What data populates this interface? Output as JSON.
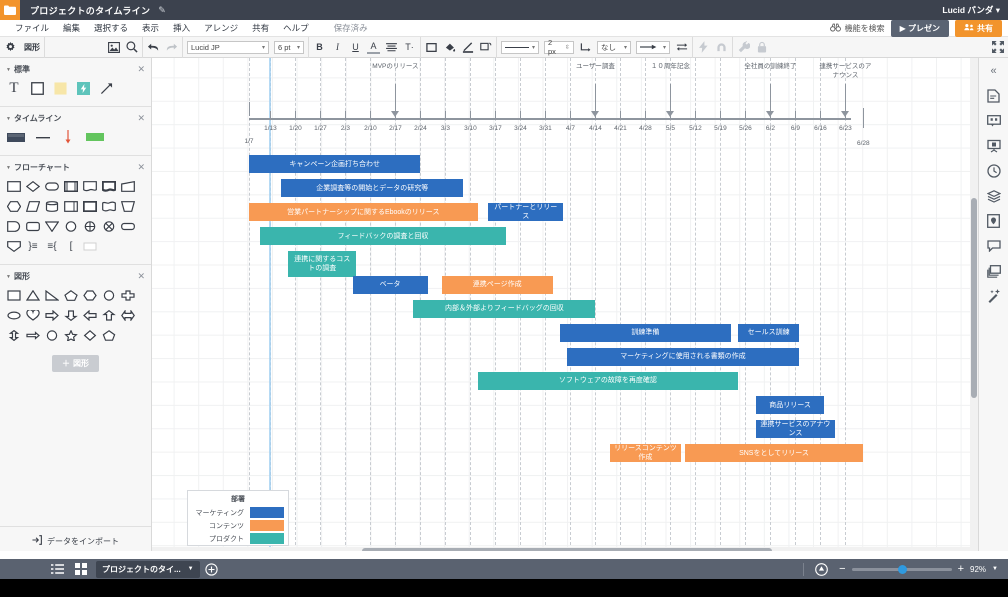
{
  "titlebar": {
    "doc_title": "プロジェクトのタイムライン",
    "edit_icon": "pencil-icon",
    "account": "Lucid パンダ ▾"
  },
  "menubar": {
    "items": [
      "ファイル",
      "編集",
      "選択する",
      "表示",
      "挿入",
      "アレンジ",
      "共有",
      "ヘルプ"
    ],
    "saved_status": "保存済み",
    "search_features": "機能を検索",
    "present_label": "▶ プレゼン",
    "share_label": "共有"
  },
  "toolbar": {
    "shapes_label": "図形",
    "font_family": "Lucid JP",
    "font_size": "6 pt",
    "bold": "B",
    "italic": "I",
    "underline": "U",
    "text_color": "A",
    "line_width": "2 px",
    "line_style_none": "なし"
  },
  "leftpanel": {
    "sections": [
      {
        "title": "標準"
      },
      {
        "title": "タイムライン"
      },
      {
        "title": "フローチャート"
      },
      {
        "title": "図形"
      }
    ],
    "add_shape_label": "図形",
    "import_label": "データをインポート"
  },
  "statusbar": {
    "page_tab": "プロジェクトのタイ...",
    "add_page": "+",
    "zoom_level": "92%"
  },
  "chart_data": {
    "type": "bar",
    "title": "プロジェクトのタイムライン",
    "subtype": "gantt",
    "axis_start_label": "1/7",
    "axis_end_label": "6/28",
    "tick_labels": [
      "1/13",
      "1/20",
      "1/27",
      "2/3",
      "2/10",
      "2/17",
      "2/24",
      "3/3",
      "3/10",
      "3/17",
      "3/24",
      "3/31",
      "4/7",
      "4/14",
      "4/21",
      "4/28",
      "5/5",
      "5/12",
      "5/19",
      "5/26",
      "6/2",
      "6/9",
      "6/16",
      "6/23"
    ],
    "milestones": [
      {
        "label": "MVPのリリース",
        "date": "2/17"
      },
      {
        "label": "ユーザー調査",
        "date": "4/14"
      },
      {
        "label": "１０周年記念",
        "date": "5/5"
      },
      {
        "label": "全社員の訓練終了",
        "date": "6/2"
      },
      {
        "label": "連携サービスのアナウンス",
        "date": "6/23"
      }
    ],
    "today_marker": "1/13",
    "legend": {
      "title": "部署",
      "entries": [
        {
          "label": "マーケティング",
          "color": "#2d6ec0"
        },
        {
          "label": "コンテンツ",
          "color": "#f89a53"
        },
        {
          "label": "プロダクト",
          "color": "#3ab5ad"
        }
      ]
    },
    "tasks": [
      {
        "label": "キャンペーン企画打ち合わせ",
        "dept": "マーケティング",
        "color": "#2d6ec0",
        "start": "1/7",
        "end": "2/24",
        "row": 0
      },
      {
        "label": "企業調査等の開始とデータの研究等",
        "dept": "マーケティング",
        "color": "#2d6ec0",
        "start": "1/16",
        "end": "3/8",
        "row": 1
      },
      {
        "label": "営業パートナーシップに関するEbookのリリース",
        "dept": "コンテンツ",
        "color": "#f89a53",
        "start": "1/7",
        "end": "3/12",
        "row": 2
      },
      {
        "label": "パートナーとリリース",
        "dept": "マーケティング",
        "color": "#2d6ec0",
        "start": "3/15",
        "end": "4/5",
        "row": 2
      },
      {
        "label": "フィードバックの調査と回収",
        "dept": "プロダクト",
        "color": "#3ab5ad",
        "start": "1/10",
        "end": "3/20",
        "row": 3
      },
      {
        "label": "連携に関するコストの調査",
        "dept": "プロダクト",
        "color": "#3ab5ad",
        "start": "1/18",
        "end": "2/6",
        "row": 4
      },
      {
        "label": "ベータ",
        "dept": "マーケティング",
        "color": "#2d6ec0",
        "start": "2/5",
        "end": "2/26",
        "row": 5
      },
      {
        "label": "連携ページ作成",
        "dept": "コンテンツ",
        "color": "#f89a53",
        "start": "3/2",
        "end": "4/2",
        "row": 5
      },
      {
        "label": "内部＆外部よりフィードバッグの回収",
        "dept": "プロダクト",
        "color": "#3ab5ad",
        "start": "2/22",
        "end": "4/14",
        "row": 6
      },
      {
        "label": "訓練準備",
        "dept": "マーケティング",
        "color": "#2d6ec0",
        "start": "4/4",
        "end": "5/22",
        "row": 7
      },
      {
        "label": "セールス訓練",
        "dept": "マーケティング",
        "color": "#2d6ec0",
        "start": "5/24",
        "end": "6/10",
        "row": 7
      },
      {
        "label": "マーケティングに使用される書類の作成",
        "dept": "マーケティング",
        "color": "#2d6ec0",
        "start": "4/6",
        "end": "6/10",
        "row": 8
      },
      {
        "label": "ソフトウェアの故障を再度確認",
        "dept": "プロダクト",
        "color": "#3ab5ad",
        "start": "3/12",
        "end": "5/24",
        "row": 9
      },
      {
        "label": "商品リリース",
        "dept": "マーケティング",
        "color": "#2d6ec0",
        "start": "5/29",
        "end": "6/17",
        "row": 10
      },
      {
        "label": "連携サービスのアナウンス",
        "dept": "マーケティング",
        "color": "#2d6ec0",
        "start": "5/29",
        "end": "6/20",
        "row": 11
      },
      {
        "label": "リリースコンテンツ作成",
        "dept": "コンテンツ",
        "color": "#f89a53",
        "start": "4/18",
        "end": "5/8",
        "row": 12
      },
      {
        "label": "SNSをとしてリリース",
        "dept": "コンテンツ",
        "color": "#f89a53",
        "start": "5/9",
        "end": "6/28",
        "row": 12
      }
    ]
  }
}
